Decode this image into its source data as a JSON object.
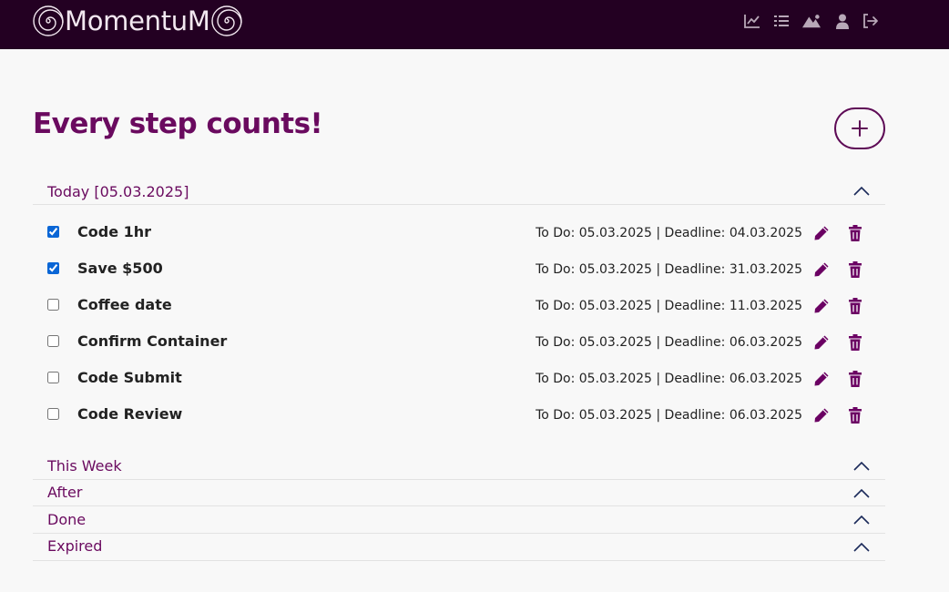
{
  "app": {
    "brand": "MomentuM"
  },
  "nav": {
    "items": [
      {
        "icon": "line-chart-icon"
      },
      {
        "icon": "list-icon"
      },
      {
        "icon": "mountain-icon"
      },
      {
        "icon": "user-icon"
      },
      {
        "icon": "logout-icon"
      }
    ]
  },
  "page": {
    "title": "Every step counts!"
  },
  "sections": [
    {
      "label": "Today [05.03.2025]",
      "expanded": true
    },
    {
      "label": "This Week",
      "expanded": false
    },
    {
      "label": "After",
      "expanded": false
    },
    {
      "label": "Done",
      "expanded": false
    },
    {
      "label": "Expired",
      "expanded": false
    }
  ],
  "tasks": [
    {
      "title": "Code 1hr",
      "dates": "To Do: 05.03.2025 | Deadline: 04.03.2025",
      "checked": true
    },
    {
      "title": "Save $500",
      "dates": "To Do: 05.03.2025 | Deadline: 31.03.2025",
      "checked": true
    },
    {
      "title": "Coffee date",
      "dates": "To Do: 05.03.2025 | Deadline: 11.03.2025",
      "checked": false
    },
    {
      "title": "Confirm Container",
      "dates": "To Do: 05.03.2025 | Deadline: 06.03.2025",
      "checked": false
    },
    {
      "title": "Code Submit",
      "dates": "To Do: 05.03.2025 | Deadline: 06.03.2025",
      "checked": false
    },
    {
      "title": "Code Review",
      "dates": "To Do: 05.03.2025 | Deadline: 06.03.2025",
      "checked": false
    }
  ],
  "colors": {
    "navbar": "#230022",
    "accent": "#6a0a5f",
    "icon_action": "#6b0063",
    "chevron": "#1b2a5a",
    "background": "#f8f8f8",
    "checkbox": "#0a66d6"
  }
}
